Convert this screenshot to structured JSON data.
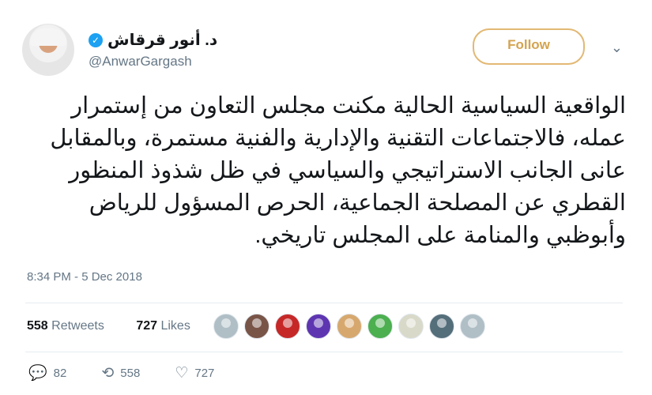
{
  "header": {
    "display_name": "د. أنور قرقاش",
    "handle": "@AnwarGargash",
    "follow_label": "Follow"
  },
  "tweet": {
    "text": "الواقعية السياسية الحالية مكنت مجلس التعاون من إستمرار عمله، فالاجتماعات التقنية والإدارية والفنية مستمرة، وبالمقابل عانى الجانب الاستراتيجي والسياسي في ظل شذوذ المنظور القطري عن المصلحة الجماعية، الحرص المسؤول للرياض وأبوظبي والمنامة على المجلس تاريخي.",
    "timestamp": "8:34 PM - 5 Dec 2018"
  },
  "stats": {
    "retweets_count": "558",
    "retweets_label": "Retweets",
    "likes_count": "727",
    "likes_label": "Likes"
  },
  "retweeters": [
    {
      "color": "#b0bec5"
    },
    {
      "color": "#795548"
    },
    {
      "color": "#c62828"
    },
    {
      "color": "#5e35b1"
    },
    {
      "color": "#d7a86e"
    },
    {
      "color": "#4caf50"
    },
    {
      "color": "#d9d9c9"
    },
    {
      "color": "#546e7a"
    },
    {
      "color": "#b0bec5"
    }
  ],
  "actions": {
    "replies": "82",
    "retweets": "558",
    "likes": "727"
  },
  "colors": {
    "follow": "#d4a450",
    "verified": "#1da1f2",
    "muted": "#657786"
  }
}
